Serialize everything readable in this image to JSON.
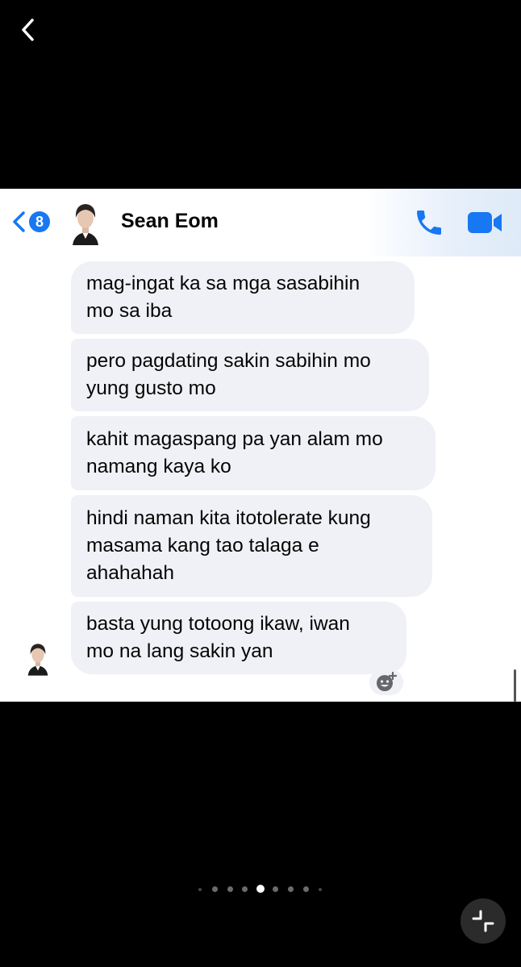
{
  "contact": {
    "name": "Sean Eom"
  },
  "header": {
    "unread_count": "8"
  },
  "messages": [
    {
      "text": "mag-ingat ka sa mga sasabihin\nmo sa iba"
    },
    {
      "text": "pero pagdating sakin sabihin mo\nyung gusto mo"
    },
    {
      "text": "kahit magaspang pa yan alam mo\nnamang kaya ko"
    },
    {
      "text": "hindi naman kita itotolerate kung\nmasama kang tao talaga e\nahahahah"
    },
    {
      "text": "basta yung totoong ikaw, iwan\nmo na lang sakin yan"
    }
  ],
  "icons": {
    "back": "chevron-left-icon",
    "call": "phone-icon",
    "video": "video-camera-icon",
    "react": "add-reaction-icon",
    "collapse": "collapse-icon"
  },
  "carousel": {
    "total": 9,
    "active_index": 4
  },
  "colors": {
    "accent": "#1877f2",
    "bubble": "#eff1f6",
    "background": "#000000"
  }
}
